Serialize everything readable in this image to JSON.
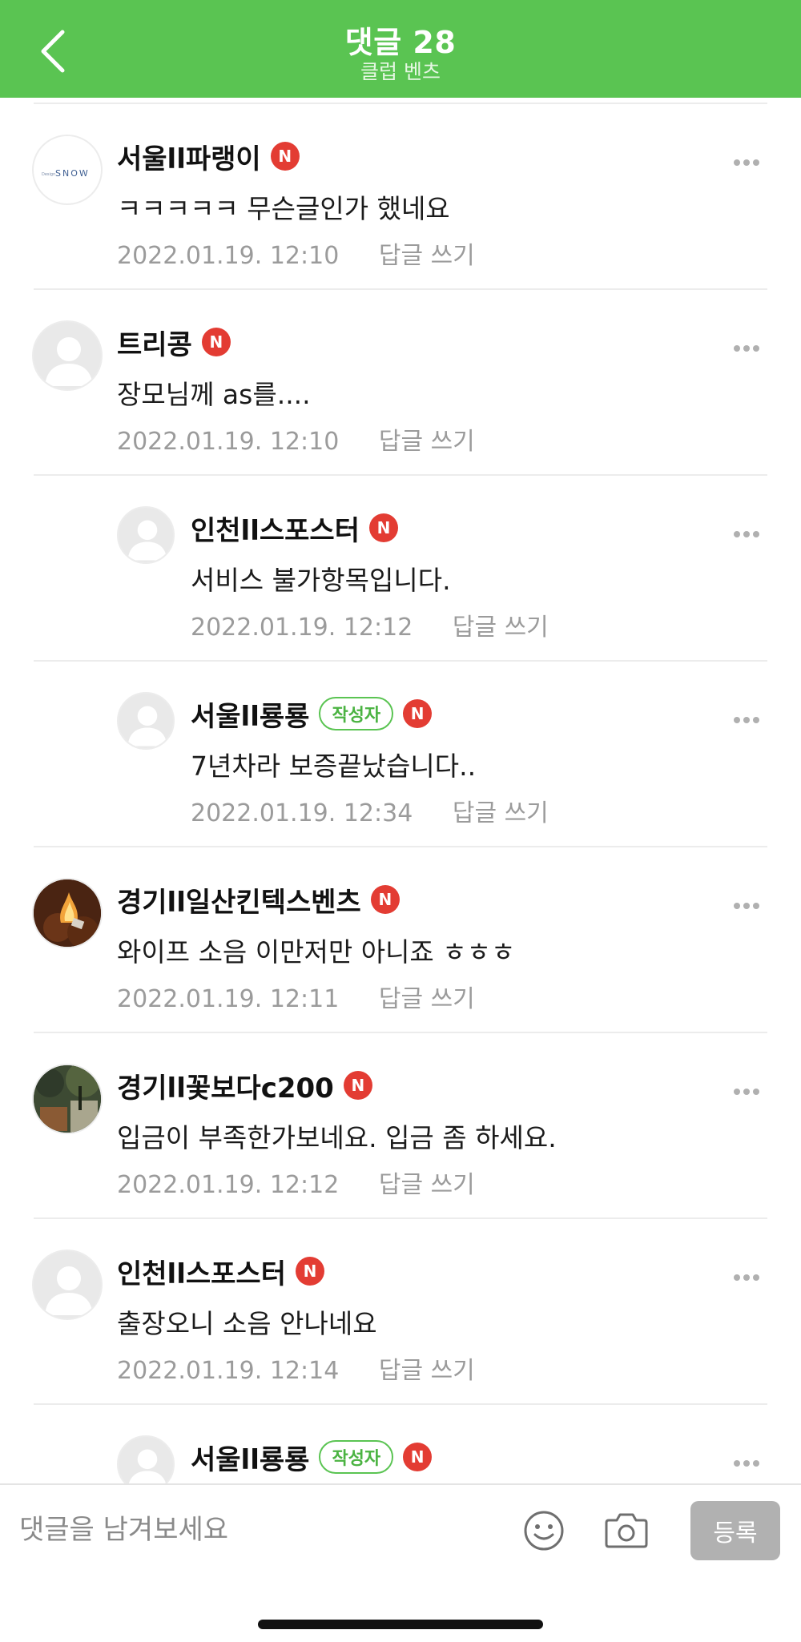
{
  "header": {
    "title": "댓글 28",
    "subtitle": "클럽 벤츠"
  },
  "badge": {
    "n": "N",
    "writer": "작성자"
  },
  "comments": [
    {
      "name": "서울ll파랭이",
      "text": "ㅋㅋㅋㅋㅋ 무슨글인가 했네요",
      "time": "2022.01.19. 12:10",
      "reply": "답글 쓰기",
      "avatar": "snow-logo",
      "logo_text": "SNOW",
      "logo_small": "Design"
    },
    {
      "name": "트리콩",
      "text": "장모님께 as를....",
      "time": "2022.01.19. 12:10",
      "reply": "답글 쓰기",
      "avatar": "default"
    },
    {
      "name": "인천ll스포스터",
      "text": "서비스 불가항목입니다.",
      "time": "2022.01.19. 12:12",
      "reply": "답글 쓰기",
      "avatar": "default"
    },
    {
      "name": "서울ll룡룡",
      "text": "7년차라 보증끝났습니다..",
      "time": "2022.01.19. 12:34",
      "reply": "답글 쓰기",
      "avatar": "default"
    },
    {
      "name": "경기ll일산킨텍스벤츠",
      "text": "와이프 소음 이만저만 아니죠 ㅎㅎㅎ",
      "time": "2022.01.19. 12:11",
      "reply": "답글 쓰기",
      "avatar": "fire-photo"
    },
    {
      "name": "경기ll꽃보다c200",
      "text": "입금이 부족한가보네요. 입금 좀 하세요.",
      "time": "2022.01.19. 12:12",
      "reply": "답글 쓰기",
      "avatar": "garden-photo"
    },
    {
      "name": "인천ll스포스터",
      "text": "출장오니 소음 안나네요",
      "time": "2022.01.19. 12:14",
      "reply": "답글 쓰기",
      "avatar": "default"
    },
    {
      "name": "서울ll룡룡",
      "avatar": "default"
    }
  ],
  "input": {
    "placeholder": "댓글을 남겨보세요",
    "submit": "등록"
  },
  "colors": {
    "accent": "#5ac452",
    "badge_red": "#e33c33",
    "submit_disabled": "#b1b1b1"
  }
}
